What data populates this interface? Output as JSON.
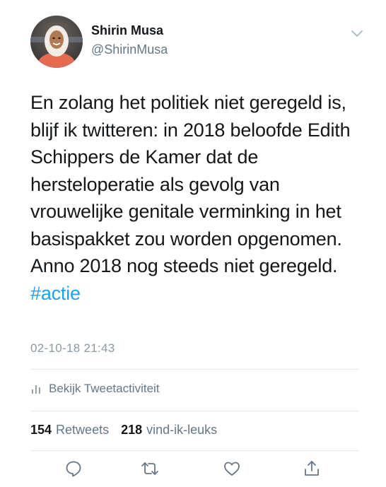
{
  "tweet": {
    "author_name": "Shirin Musa",
    "author_handle": "@ShirinMusa",
    "text_body": "En zolang het politiek niet geregeld is, blijf ik twitteren: in 2018 beloofde Edith Schippers de Kamer dat de hersteloperatie als gevolg van vrouwelijke genitale verminking in het basispakket zou worden opgenomen. Anno 2018 nog steeds niet geregeld. ",
    "hashtag": "#actie",
    "timestamp": "02-10-18 21:43",
    "activity_label": "Bekijk Tweetactiviteit",
    "retweets_count": "154",
    "retweets_label": "Retweets",
    "likes_count": "218",
    "likes_label": "vind-ik-leuks"
  },
  "icons": {
    "menu": "chevron-down-icon",
    "activity": "bar-chart-icon",
    "reply": "reply-icon",
    "retweet": "retweet-icon",
    "like": "heart-icon",
    "share": "share-icon"
  },
  "colors": {
    "text": "#14171a",
    "secondary": "#657786",
    "timestamp": "#8899a6",
    "link": "#1da1f2",
    "divider": "#e1e8ed"
  }
}
